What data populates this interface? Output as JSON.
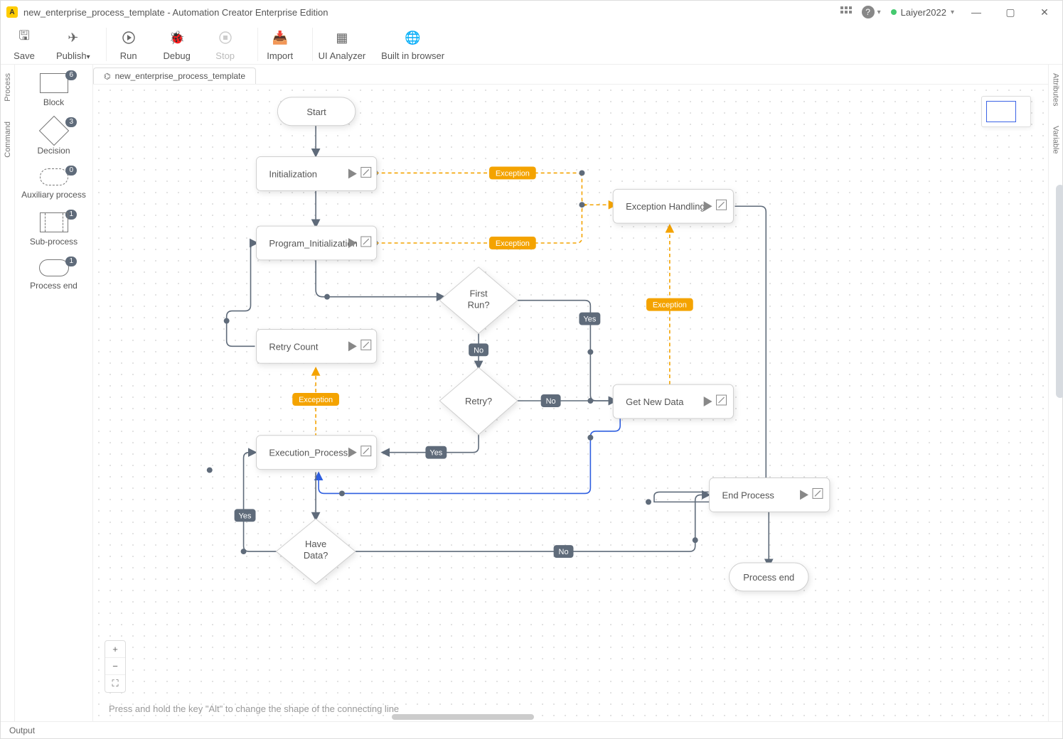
{
  "window": {
    "title_project": "new_enterprise_process_template",
    "title_app": "Automation Creator Enterprise Edition",
    "title_full": "new_enterprise_process_template - Automation Creator Enterprise Edition",
    "user_name": "Laiyer2022",
    "user_status_color": "#45c96f"
  },
  "toolbar": {
    "save": "Save",
    "publish": "Publish",
    "run": "Run",
    "debug": "Debug",
    "stop": "Stop",
    "import": "Import",
    "ui_analyzer": "UI Analyzer",
    "built_in_browser": "Built in browser"
  },
  "left_rail": {
    "process": "Process",
    "command": "Command"
  },
  "right_rail": {
    "attributes": "Attributes",
    "variable": "Variable"
  },
  "palette": {
    "block": {
      "label": "Block",
      "count": "6"
    },
    "decision": {
      "label": "Decision",
      "count": "3"
    },
    "auxiliary": {
      "label": "Auxiliary process",
      "count": "0"
    },
    "sub": {
      "label": "Sub-process",
      "count": "1"
    },
    "end": {
      "label": "Process end",
      "count": "1"
    }
  },
  "tab": {
    "label": "new_enterprise_process_template"
  },
  "hint": "Press and hold the key \"Alt\" to change the shape of the connecting line",
  "output_bar": "Output",
  "flow": {
    "nodes": {
      "start": "Start",
      "init": "Initialization",
      "prog_init": "Program_Initialization",
      "first_run_l1": "First",
      "first_run_l2": "Run?",
      "retry_count": "Retry Count",
      "retry_q": "Retry?",
      "exec": "Execution_Process",
      "have_data_l1": "Have",
      "have_data_l2": "Data?",
      "exception_handling": "Exception Handling",
      "get_new_data": "Get New Data",
      "end_process": "End Process",
      "process_end": "Process end"
    },
    "labels": {
      "yes": "Yes",
      "no": "No",
      "exception": "Exception"
    }
  },
  "chart_data": {
    "type": "flowchart",
    "title": "new_enterprise_process_template",
    "nodes": [
      {
        "id": "start",
        "type": "terminator",
        "label": "Start"
      },
      {
        "id": "initialization",
        "type": "process",
        "label": "Initialization"
      },
      {
        "id": "program_init",
        "type": "process",
        "label": "Program_Initialization"
      },
      {
        "id": "first_run",
        "type": "decision",
        "label": "First Run?"
      },
      {
        "id": "retry_count",
        "type": "process",
        "label": "Retry Count"
      },
      {
        "id": "retry",
        "type": "decision",
        "label": "Retry?"
      },
      {
        "id": "execution_process",
        "type": "process",
        "label": "Execution_Process"
      },
      {
        "id": "have_data",
        "type": "decision",
        "label": "Have Data?"
      },
      {
        "id": "get_new_data",
        "type": "process",
        "label": "Get New Data"
      },
      {
        "id": "exception_handling",
        "type": "process",
        "label": "Exception Handling"
      },
      {
        "id": "end_process",
        "type": "process",
        "label": "End Process"
      },
      {
        "id": "process_end",
        "type": "terminator",
        "label": "Process end"
      }
    ],
    "edges": [
      {
        "from": "start",
        "to": "initialization",
        "label": null,
        "style": "normal"
      },
      {
        "from": "initialization",
        "to": "program_init",
        "label": null,
        "style": "normal"
      },
      {
        "from": "initialization",
        "to": "exception_handling",
        "label": "Exception",
        "style": "exception"
      },
      {
        "from": "program_init",
        "to": "first_run",
        "label": null,
        "style": "normal"
      },
      {
        "from": "program_init",
        "to": "exception_handling",
        "label": "Exception",
        "style": "exception"
      },
      {
        "from": "first_run",
        "to": "get_new_data",
        "label": "Yes",
        "style": "normal"
      },
      {
        "from": "first_run",
        "to": "retry",
        "label": "No",
        "style": "normal"
      },
      {
        "from": "retry",
        "to": "get_new_data",
        "label": "No",
        "style": "normal"
      },
      {
        "from": "retry",
        "to": "execution_process",
        "label": "Yes",
        "style": "normal"
      },
      {
        "from": "retry_count",
        "to": "program_init",
        "label": null,
        "style": "normal"
      },
      {
        "from": "execution_process",
        "to": "have_data",
        "label": null,
        "style": "normal"
      },
      {
        "from": "execution_process",
        "to": "retry_count",
        "label": "Exception",
        "style": "exception"
      },
      {
        "from": "get_new_data",
        "to": "execution_process",
        "label": null,
        "style": "highlighted"
      },
      {
        "from": "get_new_data",
        "to": "exception_handling",
        "label": "Exception",
        "style": "exception"
      },
      {
        "from": "have_data",
        "to": "execution_process",
        "label": "Yes",
        "style": "normal"
      },
      {
        "from": "have_data",
        "to": "end_process",
        "label": "No",
        "style": "normal"
      },
      {
        "from": "end_process",
        "to": "process_end",
        "label": null,
        "style": "normal"
      },
      {
        "from": "exception_handling",
        "to": "end_process",
        "label": null,
        "style": "normal"
      }
    ]
  }
}
